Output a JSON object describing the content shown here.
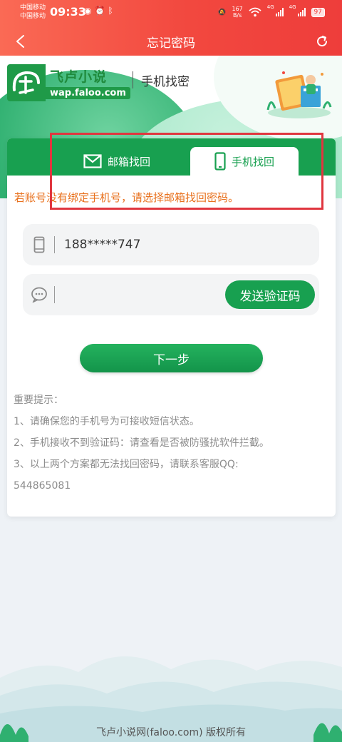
{
  "status_bar": {
    "carrier_1": "中国移动",
    "carrier_2": "中国移动",
    "time": "09:33",
    "net_speed_value": "167",
    "net_speed_unit": "B/s",
    "net_type_1": "4G",
    "net_type_2": "4G",
    "battery": "97"
  },
  "header": {
    "title": "忘记密码",
    "back_icon": "back-arrow-icon",
    "refresh_icon": "refresh-icon"
  },
  "hero": {
    "logo_cn": "飞卢小说",
    "logo_url": "wap.faloo.com",
    "subtitle": "手机找密"
  },
  "tabs": [
    {
      "label": "邮箱找回",
      "icon": "envelope-icon",
      "active": false
    },
    {
      "label": "手机找回",
      "icon": "phone-icon",
      "active": true
    }
  ],
  "notice": "若账号没有绑定手机号，请选择邮箱找回密码。",
  "form": {
    "phone_value": "188*****747",
    "code_value": "",
    "send_code_label": "发送验证码",
    "next_label": "下一步"
  },
  "tips": {
    "title": "重要提示：",
    "items": [
      "1、请确保您的手机号为可接收短信状态。",
      "2、手机接收不到验证码：请查看是否被防骚扰软件拦截。",
      "3、以上两个方案都无法找回密码，请联系客服QQ:"
    ],
    "qq": "544865081"
  },
  "footer": "飞卢小说网(faloo.com) 版权所有",
  "colors": {
    "header_red": "#f2483f",
    "brand_green": "#18a050",
    "notice_orange": "#e8701c",
    "highlight_red": "#e0363f"
  }
}
